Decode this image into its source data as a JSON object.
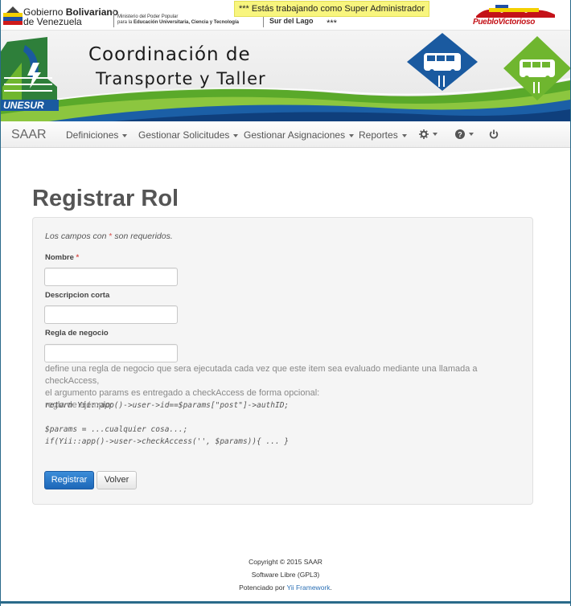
{
  "gov": {
    "name_line1_a": "Gobierno ",
    "name_line1_b": "Bolivariano",
    "name_line2": "de Venezuela",
    "ministry_line1": "Ministerio del Poder Popular",
    "ministry_line2_a": "para la ",
    "ministry_line2_b": "Educación Universitaria, Ciencia y Tecnología",
    "region": "Sur del Lago",
    "logo_text": "PuebloVictorioso"
  },
  "notice": "*** Estás trabajando como Super Administrador ***",
  "banner": {
    "title_line1": "Coordinación de",
    "title_line2": "Transporte y Taller",
    "logo_text": "UNESUR"
  },
  "navbar": {
    "brand": "SAAR",
    "items": [
      {
        "label": "Definiciones"
      },
      {
        "label": "Gestionar Solicitudes"
      },
      {
        "label": "Gestionar Asignaciones"
      },
      {
        "label": "Reportes"
      }
    ]
  },
  "page": {
    "title": "Registrar Rol"
  },
  "form": {
    "required_note_a": "Los campos con ",
    "required_star": "*",
    "required_note_b": " son requeridos.",
    "nombre_label": "Nombre",
    "nombre_value": "",
    "descripcion_label": "Descripcion corta",
    "descripcion_value": "",
    "regla_label": "Regla de negocio",
    "regla_value": "",
    "hint_line1": "define una regla de negocio que sera ejecutada cada vez que este item sea evaluado mediante una llamada a checkAccess,",
    "hint_line2": "el argumento params es entregado a checkAccess de forma opcional:",
    "hint_line3": "regla de ejemplo:",
    "code_line1": "return Yii::app()->user->id==$params[\"post\"]->authID;",
    "code_line2": "$params = ...cualquier cosa...;",
    "code_line3": "if(Yii::app()->user->checkAccess('', $params)){ ... }",
    "submit_label": "Registrar",
    "back_label": "Volver"
  },
  "footer": {
    "copyright": "Copyright © 2015 SAAR",
    "license": "Software Libre (GPL3)",
    "powered_a": "Potenciado por ",
    "powered_link": "Yii Framework",
    "powered_b": "."
  },
  "colors": {
    "primary": "#1d67b8",
    "notice_bg": "#f8f57e",
    "brand_red": "#c41218",
    "banner_green": "#6fb62f",
    "banner_blue": "#1a5aa0"
  }
}
